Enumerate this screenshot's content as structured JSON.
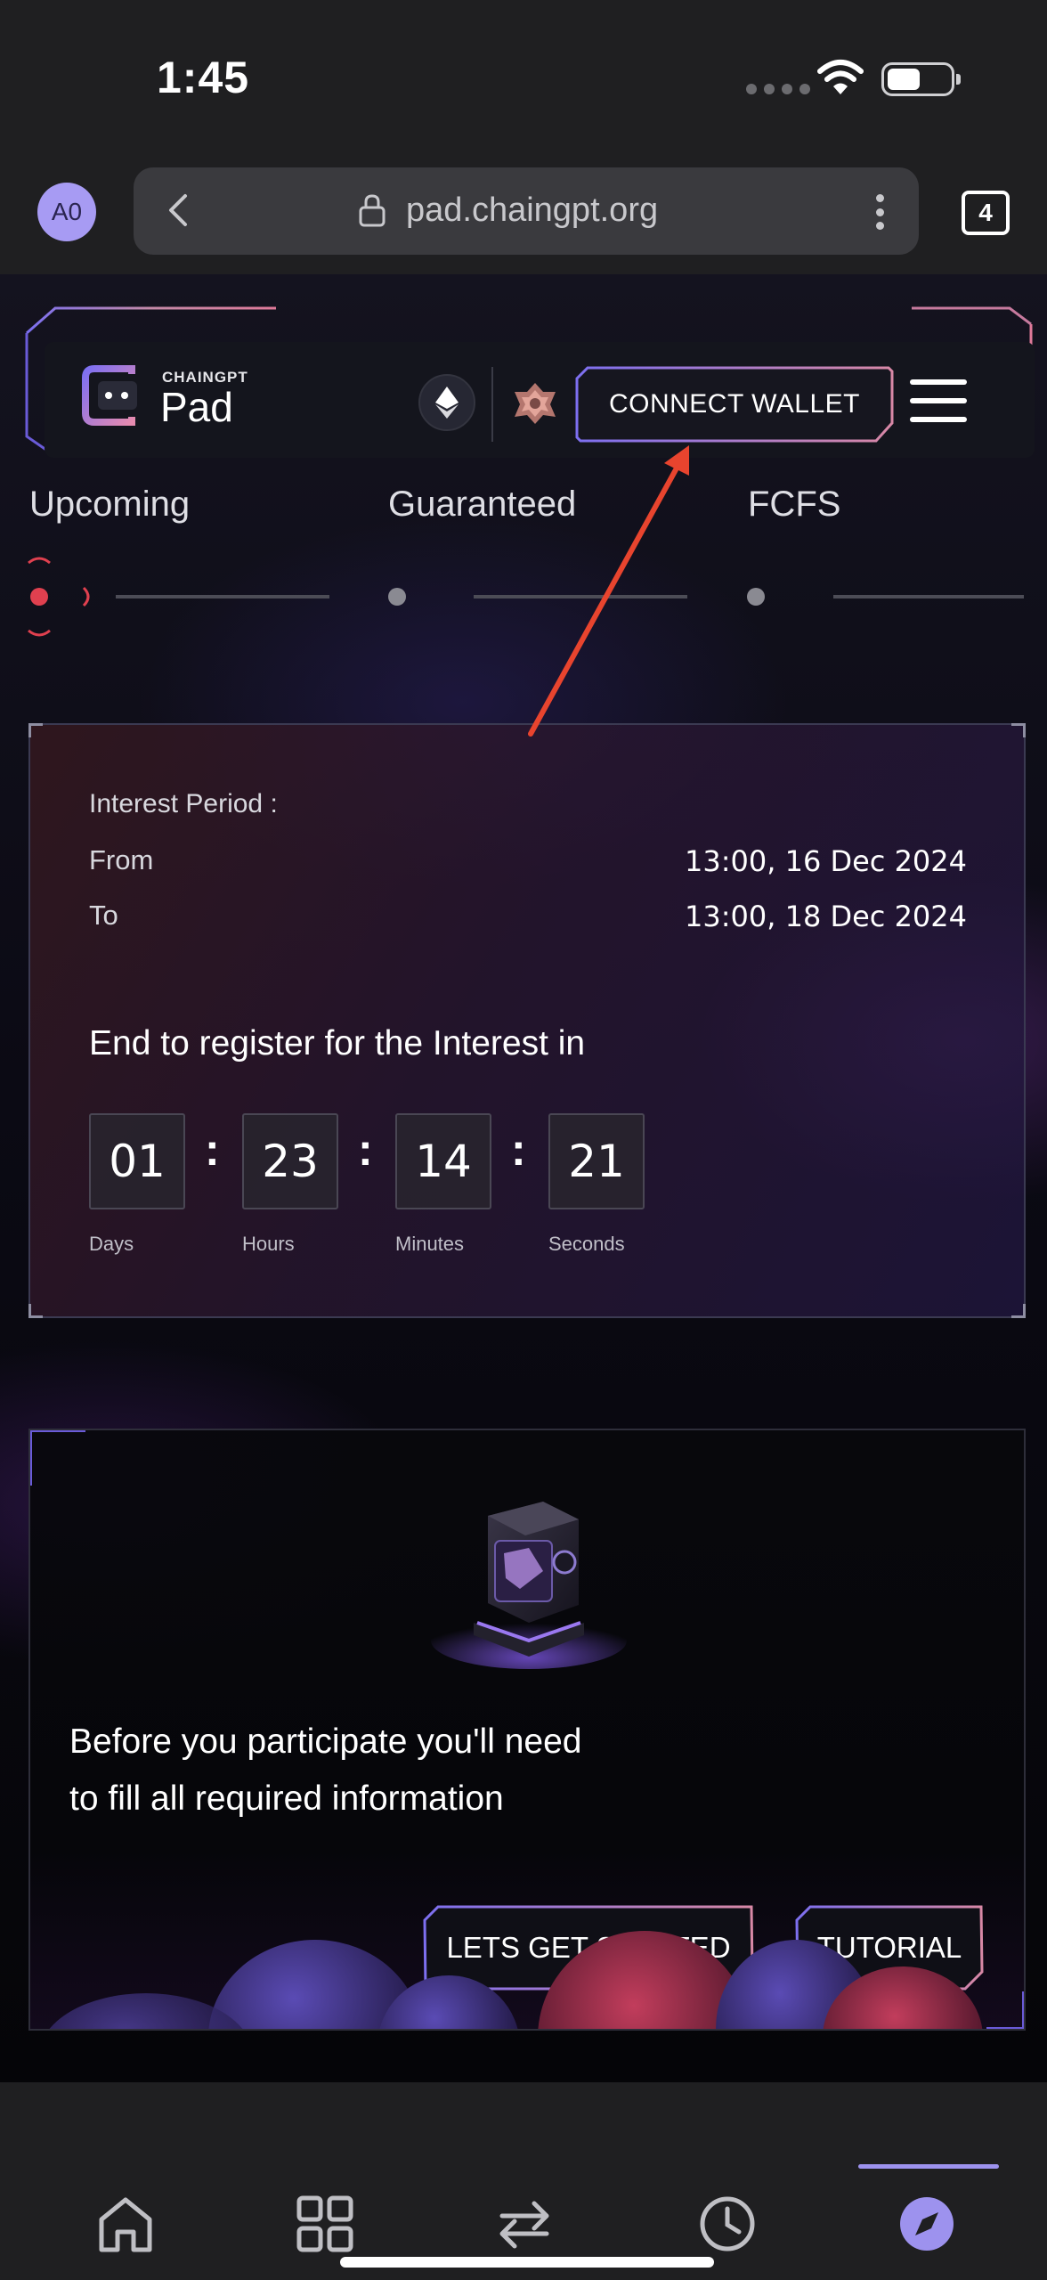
{
  "status_bar": {
    "time": "1:45"
  },
  "browser": {
    "avatar_initials": "A0",
    "url": "pad.chaingpt.org",
    "tab_count": "4"
  },
  "header": {
    "logo_small": "CHAINGPT",
    "logo_big": "Pad",
    "connect_wallet": "CONNECT WALLET",
    "network_icon": "ethereum-icon",
    "accent_color": "#8f7cf0"
  },
  "stepper": {
    "steps": [
      {
        "label": "Upcoming",
        "active": true
      },
      {
        "label": "Guaranteed",
        "active": false
      },
      {
        "label": "FCFS",
        "active": false
      }
    ],
    "active_color": "#e0404f"
  },
  "interest": {
    "title": "Interest Period :",
    "from_label": "From",
    "from_value": "13:00, 16 Dec 2024",
    "to_label": "To",
    "to_value": "13:00, 18 Dec 2024",
    "register_text": "End to register for the Interest in",
    "countdown": [
      {
        "value": "01",
        "unit": "Days"
      },
      {
        "value": "23",
        "unit": "Hours"
      },
      {
        "value": "14",
        "unit": "Minutes"
      },
      {
        "value": "21",
        "unit": "Seconds"
      }
    ]
  },
  "participate": {
    "text_line1": "Before you participate you'll need",
    "text_line2": "to fill all required information",
    "start_button": "LETS GET STARTED",
    "tutorial_button": "TUTORIAL"
  },
  "bottom_nav": {
    "items": [
      "home-icon",
      "apps-grid-icon",
      "swap-arrows-icon",
      "history-clock-icon",
      "compass-explore-icon"
    ],
    "active_index": 4
  }
}
